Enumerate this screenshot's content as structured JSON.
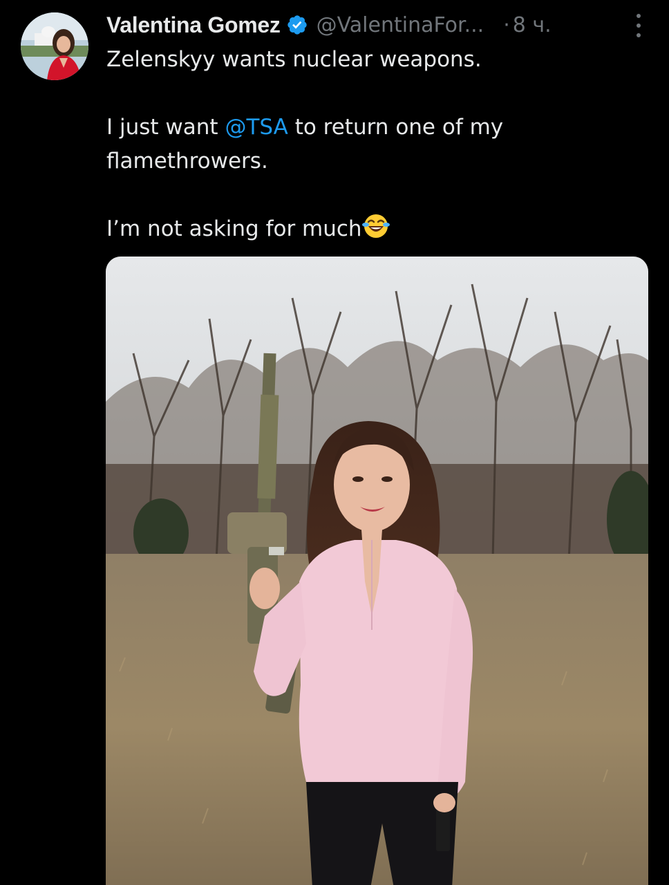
{
  "author": {
    "display_name": "Valentina Gomez",
    "handle": "@ValentinaFor...",
    "separator": "·",
    "time": "8 ч.",
    "verified": true,
    "avatar_icon": "profile-photo"
  },
  "tweet": {
    "line1": "Zelenskyy wants nuclear weapons.",
    "line2_prefix": "I just want ",
    "mention": "@TSA",
    "line2_suffix": " to return one of my",
    "line3": "flamethrowers.",
    "line4": "I’m not asking for much",
    "emoji": "😂"
  },
  "media": {
    "type": "photo",
    "description_icon": "attached-photo"
  },
  "colors": {
    "background": "#000000",
    "text": "#e7e9ea",
    "secondary": "#71767b",
    "link": "#1d9bf0",
    "verified": "#1d9bf0"
  }
}
